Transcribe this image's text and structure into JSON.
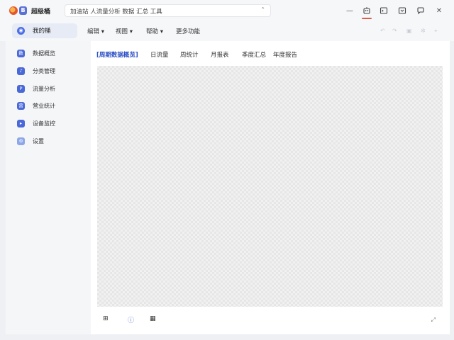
{
  "titlebar": {
    "app_title": "超级桶",
    "search_query": "加油站 人流量分析 数据 汇总 工具",
    "search_chevron": "⌃⌄",
    "buttons": [
      {
        "name": "robot-icon"
      },
      {
        "name": "terminal-icon"
      },
      {
        "name": "window-icon"
      },
      {
        "name": "chat-icon"
      },
      {
        "name": "close-icon"
      }
    ],
    "close_glyph": "✕",
    "minimize_glyph": "—"
  },
  "subbar": {
    "home_tab_label": "我的桶",
    "home_tab_icon_glyph": "◉",
    "menus": [
      {
        "label": "编辑 ▾"
      },
      {
        "label": "视图 ▾"
      },
      {
        "label": "帮助 ▾"
      },
      {
        "label": "更多功能"
      }
    ]
  },
  "sidebar": {
    "items": [
      {
        "label": "数据概览",
        "glyph": "数",
        "light": false
      },
      {
        "label": "分类管理",
        "glyph": "♪",
        "light": false
      },
      {
        "label": "流量分析",
        "glyph": "P",
        "light": false
      },
      {
        "label": "营业统计",
        "glyph": "营",
        "light": false
      },
      {
        "label": "设备监控",
        "glyph": "▸",
        "light": false
      },
      {
        "label": "设置",
        "glyph": "⚙",
        "light": true
      }
    ]
  },
  "main": {
    "tabs": [
      {
        "label": "[周期数据概览]",
        "active": true
      },
      {
        "label": "日流量",
        "active": false
      },
      {
        "label": "周统计",
        "active": false
      },
      {
        "label": "月报表",
        "active": false
      },
      {
        "label": "季度汇总",
        "active": false
      },
      {
        "label": "年度报告",
        "active": false
      }
    ],
    "bottom": {
      "btn1": "⊞",
      "btn2": "ⓘ",
      "btn3": "▦",
      "expand": "⤢"
    }
  },
  "colors": {
    "accent": "#4b6fe3",
    "active_tab": "#2d4fc6",
    "close_underline": "#e25a4a"
  }
}
